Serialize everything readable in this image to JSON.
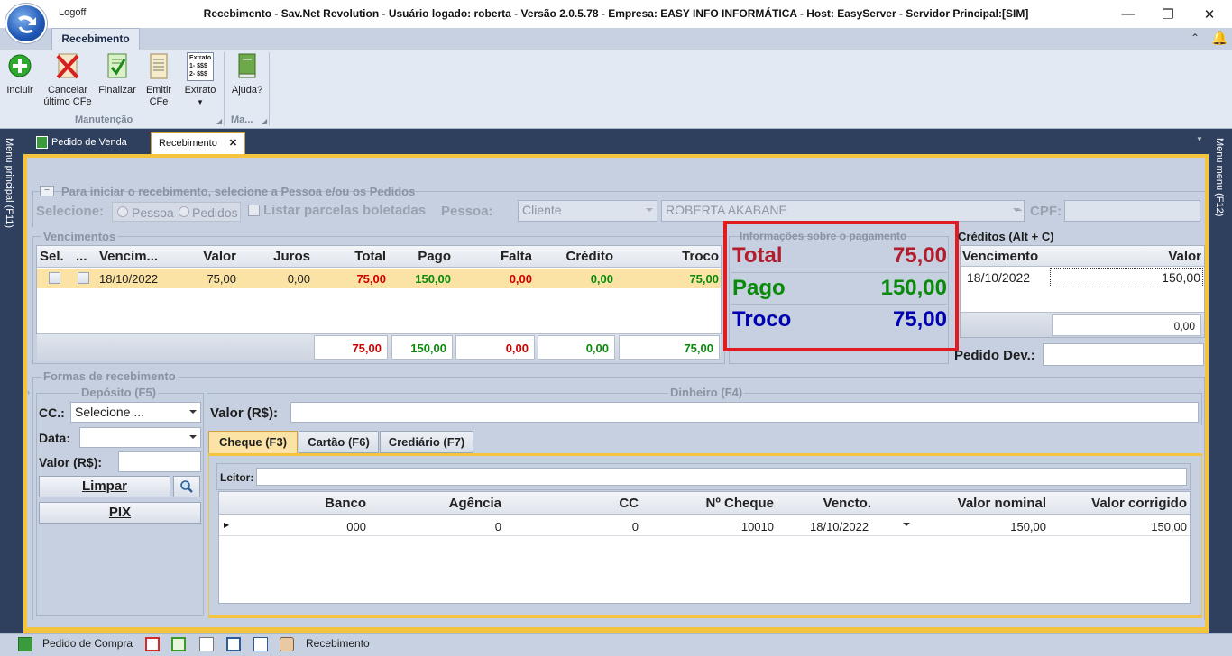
{
  "titlebar": {
    "logoff": "Logoff",
    "title": "Recebimento - Sav.Net Revolution - Usuário logado: roberta - Versão 2.0.5.78 - Empresa: EASY INFO INFORMÁTICA - Host: EasyServer - Servidor Principal:[SIM]",
    "minimize": "—",
    "maximize": "❐",
    "close": "✕"
  },
  "ribbon": {
    "tab": "Recebimento",
    "buttons": {
      "incluir": "Incluir",
      "cancelar_1": "Cancelar",
      "cancelar_2": "último CFe",
      "finalizar": "Finalizar",
      "emitir_1": "Emitir",
      "emitir_2": "CFe",
      "extrato": "Extrato",
      "ajuda": "Ajuda?"
    },
    "extrato_icon_lines": [
      "Extrato",
      "1- $$$",
      "2- $$$"
    ],
    "groups": {
      "manutencao": "Manutenção",
      "ma": "Ma..."
    }
  },
  "sidebars": {
    "left": "Menu principal (F11)",
    "right": "Menu menu (F12)"
  },
  "doc_tabs": {
    "pedido": "Pedido de Venda",
    "recebimento": "Recebimento",
    "close": "✕"
  },
  "header": {
    "hint": "Para iniciar o recebimento, selecione a Pessoa e/ou os Pedidos",
    "selecione_label": "Selecione:",
    "radio_pessoa": "Pessoa",
    "radio_pedidos": "Pedidos",
    "listar": "Listar parcelas boletadas",
    "pessoa_label": "Pessoa:",
    "pessoa_type": "Cliente",
    "pessoa_name": "ROBERTA AKABANE",
    "dash": "−",
    "cpf_label": "CPF:",
    "cpf_value": ""
  },
  "vencimentos": {
    "title": "Vencimentos",
    "columns": [
      "Sel.",
      "...",
      "Vencim...",
      "Valor",
      "Juros",
      "Total",
      "Pago",
      "Falta",
      "Crédito",
      "Troco"
    ],
    "row": {
      "vencimento": "18/10/2022",
      "valor": "75,00",
      "juros": "0,00",
      "total": "75,00",
      "pago": "150,00",
      "falta": "0,00",
      "credito": "0,00",
      "troco": "75,00"
    },
    "totals": {
      "total": "75,00",
      "pago": "150,00",
      "falta": "0,00",
      "credito": "0,00",
      "troco": "75,00"
    }
  },
  "pagamento": {
    "title": "Informações sobre o pagamento",
    "total_label": "Total",
    "total": "75,00",
    "pago_label": "Pago",
    "pago": "150,00",
    "troco_label": "Troco",
    "troco": "75,00"
  },
  "creditos": {
    "title": "Créditos (Alt + C)",
    "col_vencimento": "Vencimento",
    "col_valor": "Valor",
    "row_vencimento": "18/10/2022",
    "row_valor": "150,00",
    "total": "0,00",
    "pedido_dev_label": "Pedido Dev.:",
    "pedido_dev": ""
  },
  "formas": {
    "title": "Formas de recebimento",
    "deposito": {
      "title": "Depósito (F5)",
      "cc_label": "CC.:",
      "cc_value": "Selecione ...",
      "data_label": "Data:",
      "data_value": "",
      "valor_label": "Valor (R$):",
      "valor_value": "",
      "limpar": "Limpar",
      "pix": "PIX"
    },
    "dinheiro": {
      "title": "Dinheiro (F4)",
      "valor_label": "Valor (R$):",
      "valor_value": ""
    },
    "tabs": [
      "Cheque (F3)",
      "Cartão (F6)",
      "Crediário (F7)"
    ],
    "cheque": {
      "leitor_label": "Leitor:",
      "leitor_value": "",
      "columns": [
        "Banco",
        "Agência",
        "CC",
        "Nº Cheque",
        "Vencto.",
        "Valor nominal",
        "Valor corrigido"
      ],
      "row": {
        "banco": "000",
        "agencia": "0",
        "cc": "0",
        "cheque": "10010",
        "vencto": "18/10/2022",
        "nominal": "150,00",
        "corrigido": "150,00"
      }
    }
  },
  "statusbar": {
    "pedido_compra": "Pedido de Compra",
    "recebimento": "Recebimento"
  },
  "colors": {
    "accent": "#f5c43f",
    "highlight": "#e11b22",
    "red": "#d00000",
    "green": "#0a8a0a",
    "blue": "#0000b0",
    "darkred": "#b21d2b"
  }
}
